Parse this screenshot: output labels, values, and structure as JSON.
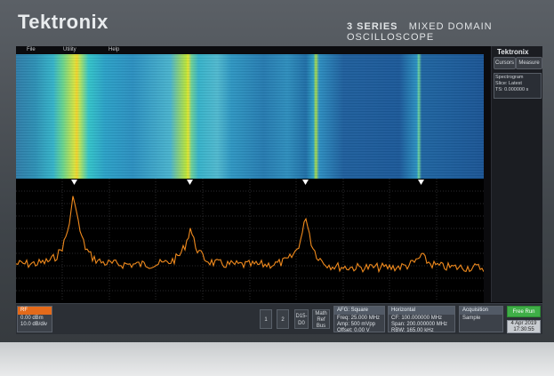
{
  "device": {
    "brand": "Tektronix",
    "series_bold": "3 SERIES",
    "series_text": "MIXED DOMAIN OSCILLOSCOPE"
  },
  "menu": {
    "file": "File",
    "utility": "Utility",
    "help": "Help"
  },
  "side_panel": {
    "logo": "Tektronix",
    "cursors": "Cursors",
    "measure": "Measure",
    "spectrogram_badge": {
      "title": "Spectrogram",
      "slice_label": "Slice: Latest",
      "ts_label": "TS:",
      "ts_value": "0.000000 s"
    }
  },
  "bottom": {
    "rf": {
      "header": "RF",
      "line1": "0.00 dBm",
      "line2": "10.0 dB/div"
    },
    "ch1": "1",
    "ch2": "2",
    "d15": "D15-D0",
    "math_ref_bus": "Math Ref Bus",
    "afg": {
      "header": "AFG: Square",
      "freq": "Freq: 25.000 MHz",
      "amp": "Amp: 500 mVpp",
      "offset": "Offset: 0.00 V"
    },
    "horizontal": {
      "header": "Horizontal",
      "cf": "CF:   100.000000 MHz",
      "span": "Span: 200.000000 MHz",
      "rbw": "RBW: 165.00 kHz"
    },
    "acquisition": {
      "header": "Acquisition",
      "mode": "Sample"
    },
    "run": "Free Run",
    "date": "4 Apr 2019",
    "time": "17:30:55"
  },
  "colors": {
    "trace": "#f08a1d",
    "accent_run": "#3fae47",
    "rf_header": "#e36a1b"
  }
}
